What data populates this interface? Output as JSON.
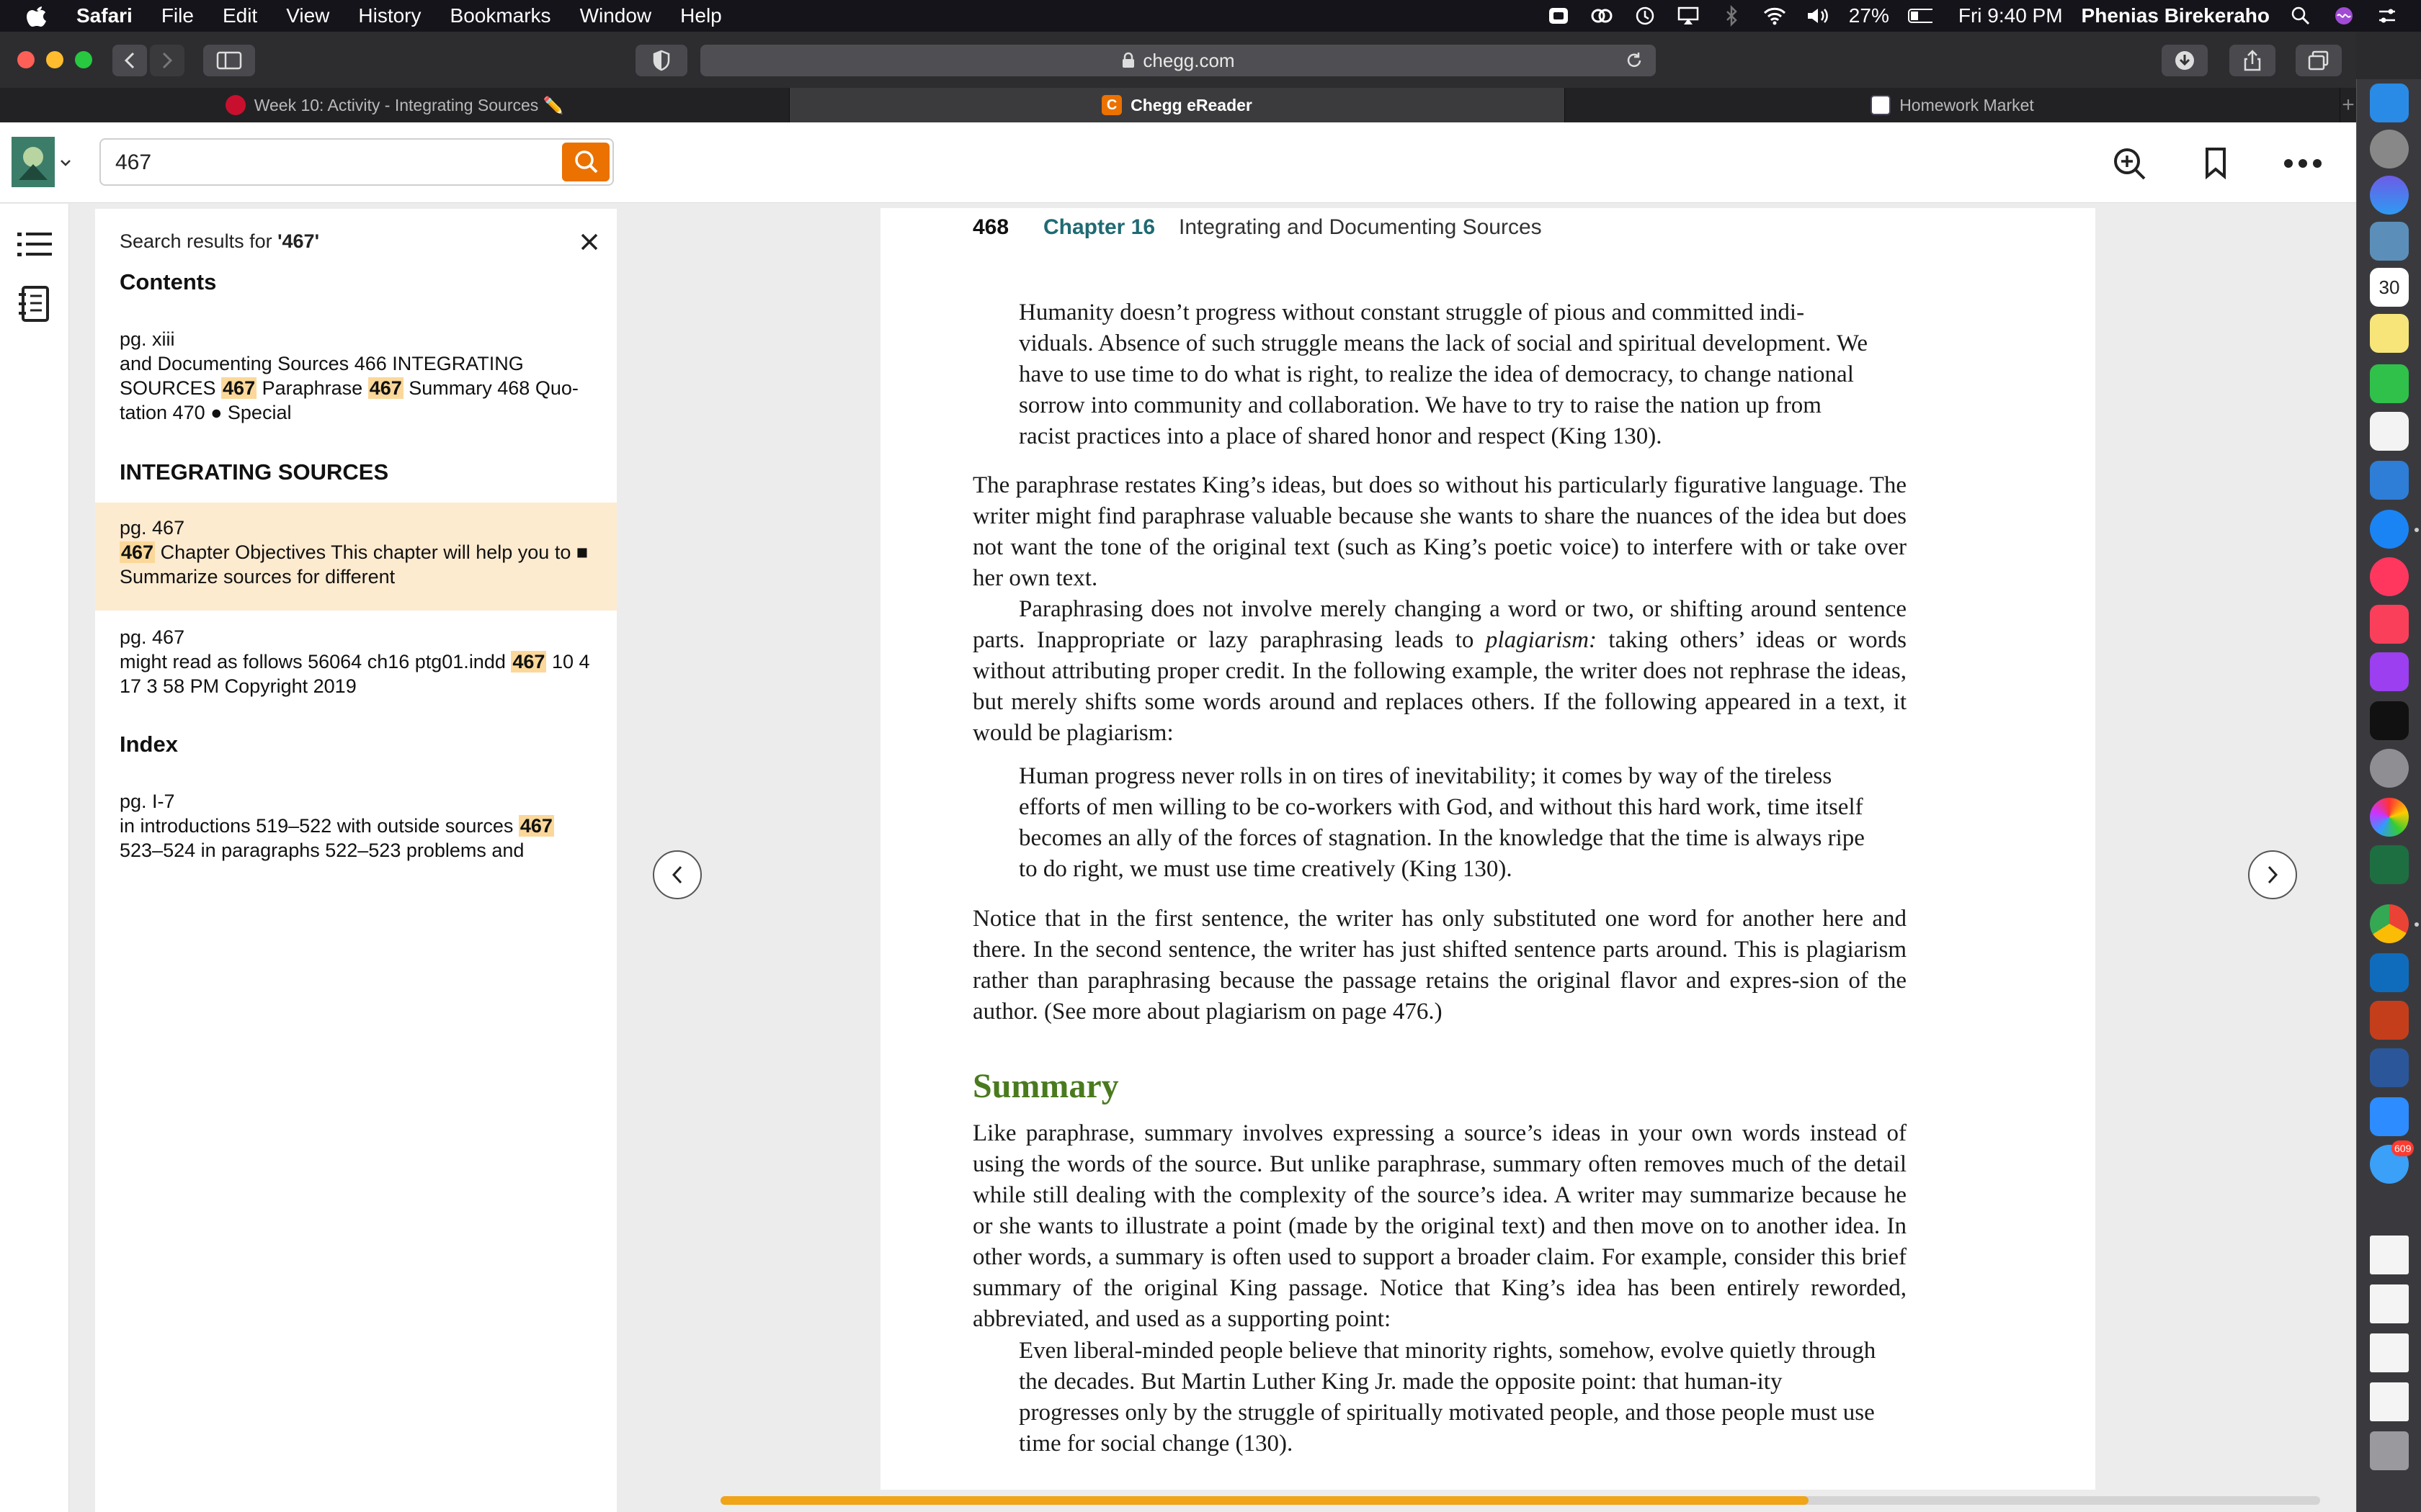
{
  "menubar": {
    "app": "Safari",
    "items": [
      "File",
      "Edit",
      "View",
      "History",
      "Bookmarks",
      "Window",
      "Help"
    ],
    "battery": "27%",
    "clock": "Fri 9:40 PM",
    "user": "Phenias Birekeraho"
  },
  "browser": {
    "url": "chegg.com",
    "tabs": [
      {
        "label": "Week 10: Activity - Integrating Sources ✏️"
      },
      {
        "label": "Chegg eReader"
      },
      {
        "label": "Homework Market"
      }
    ]
  },
  "reader_header": {
    "search_value": "467"
  },
  "search_panel": {
    "heading_prefix": "Search results for ",
    "query_display": "'467'",
    "sections": [
      {
        "title": "Contents"
      },
      {
        "title": "INTEGRATING SOURCES"
      },
      {
        "title": "Index"
      }
    ],
    "results": [
      {
        "page": "pg. xiii",
        "t1": "and Documenting Sources 466 INTEGRATING SOURCES ",
        "h1": "467",
        "t2": " Paraphrase ",
        "h2": "467",
        "t3": " Summary 468 Quo-tation 470 ● Special"
      },
      {
        "page": "pg. 467",
        "h1": "467",
        "t1": " Chapter Objectives This chapter will help you to ■ Summarize sources for different"
      },
      {
        "page": "pg. 467",
        "t1": "might read as follows 56064 ch16 ptg01.indd ",
        "h1": "467",
        "t2": " 10 4 17 3 58 PM Copyright 2019"
      },
      {
        "page": "pg. I-7",
        "t1": "in introductions 519–522 with outside sources ",
        "h1": "467",
        "t2": " 523–524 in paragraphs 522–523 problems and"
      }
    ]
  },
  "book_page": {
    "page_number": "468",
    "chapter": "Chapter 16",
    "chapter_title": "Integrating and Documenting Sources",
    "quote1": "Humanity doesn’t progress without constant struggle of pious and committed indi-viduals. Absence of such struggle means the lack of social and spiritual development. We have to use time to do what is right, to realize the idea of democracy, to change national sorrow into community and collaboration. We have to try to raise the nation up from racist practices into a place of shared honor and respect (King 130).",
    "para1": "The paraphrase restates King’s ideas, but does so without his particularly figurative language. The writer might find paraphrase valuable because she wants to share the nuances of the idea but does not want the tone of the original text (such as King’s poetic voice) to interfere with or take over her own text.",
    "para2a": "Paraphrasing does not involve merely changing a word or two, or shifting around sentence parts. Inappropriate or lazy paraphrasing leads to ",
    "para2_em": "plagiarism:",
    "para2b": " taking others’ ideas or words without attributing proper credit. In the following example, the writer does not rephrase the ideas, but merely shifts some words around and replaces others. If the following appeared in a text, it would be plagiarism:",
    "quote2": "Human progress never rolls in on tires of inevitability; it comes by way of the tireless efforts of men willing to be co-workers with God, and without this hard work, time itself becomes an ally of the forces of stagnation. In the knowledge that the time is always ripe to do right, we must use time creatively (King 130).",
    "para3": "Notice that in the first sentence, the writer has only substituted one word for another here and there. In the second sentence, the writer has just shifted sentence parts around. This is plagiarism rather than paraphrasing because the passage retains the original flavor and expres-sion of the author. (See more about plagiarism on page 476.)",
    "summary_heading": "Summary",
    "para4": "Like paraphrase, summary involves expressing a source’s ideas in your own words instead of using the words of the source. But unlike paraphrase, summary often removes much of the detail while still dealing with the complexity of the source’s idea. A writer may summarize because he or she wants to illustrate a point (made by the original text) and then move on to another idea. In other words, a summary is often used to support a broader claim. For example, consider this brief summary of the original King passage. Notice that King’s idea has been entirely reworded, abbreviated, and used as a supporting point:",
    "quote3": "Even liberal-minded people believe that minority rights, somehow, evolve quietly through the decades. But Martin Luther King Jr. made the opposite point: that human-ity progresses only by the struggle of spiritually motivated people, and those people must use time for social change (130)."
  },
  "reading_progress": 0.68,
  "dock": {
    "calendar_day": "30",
    "messages_badge": "609"
  },
  "colors": {
    "chegg_orange": "#eb7100",
    "highlight": "#fbd89a",
    "selected_result": "#fdebd0",
    "chapter_teal": "#1f6a73",
    "summary_green": "#4a7a1e"
  }
}
